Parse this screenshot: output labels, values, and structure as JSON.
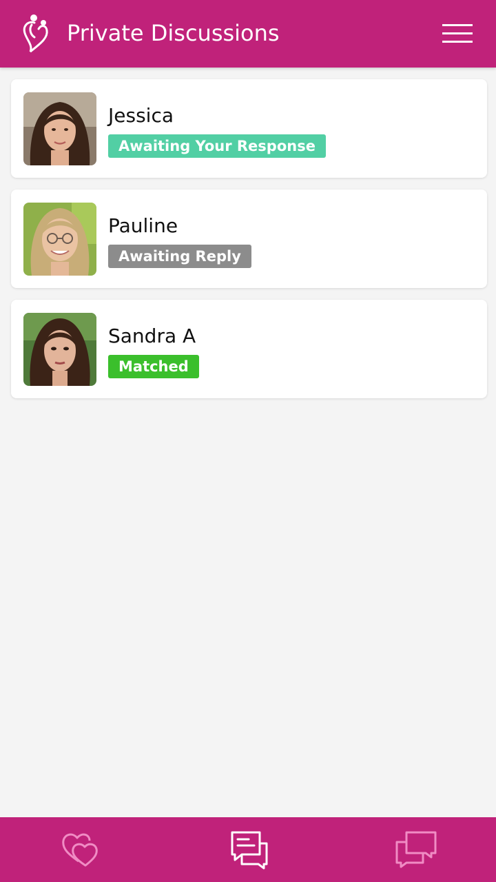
{
  "header": {
    "title": "Private Discussions",
    "logo_icon": "heart-figure-logo",
    "menu_icon": "hamburger-menu-icon",
    "background_color": "#c0227a"
  },
  "conversations": [
    {
      "name": "Jessica",
      "status": "Awaiting Your Response",
      "status_color": "#52cfa4",
      "avatar_icon": "profile-photo"
    },
    {
      "name": "Pauline",
      "status": "Awaiting Reply",
      "status_color": "#8c8c8c",
      "avatar_icon": "profile-photo"
    },
    {
      "name": "Sandra A",
      "status": "Matched",
      "status_color": "#3bbf2c",
      "avatar_icon": "profile-photo"
    }
  ],
  "bottom_nav": {
    "items": [
      {
        "icon": "hearts-icon",
        "active": false
      },
      {
        "icon": "chat-bubble-icon",
        "active": true
      },
      {
        "icon": "multi-chat-icon",
        "active": false
      }
    ]
  }
}
